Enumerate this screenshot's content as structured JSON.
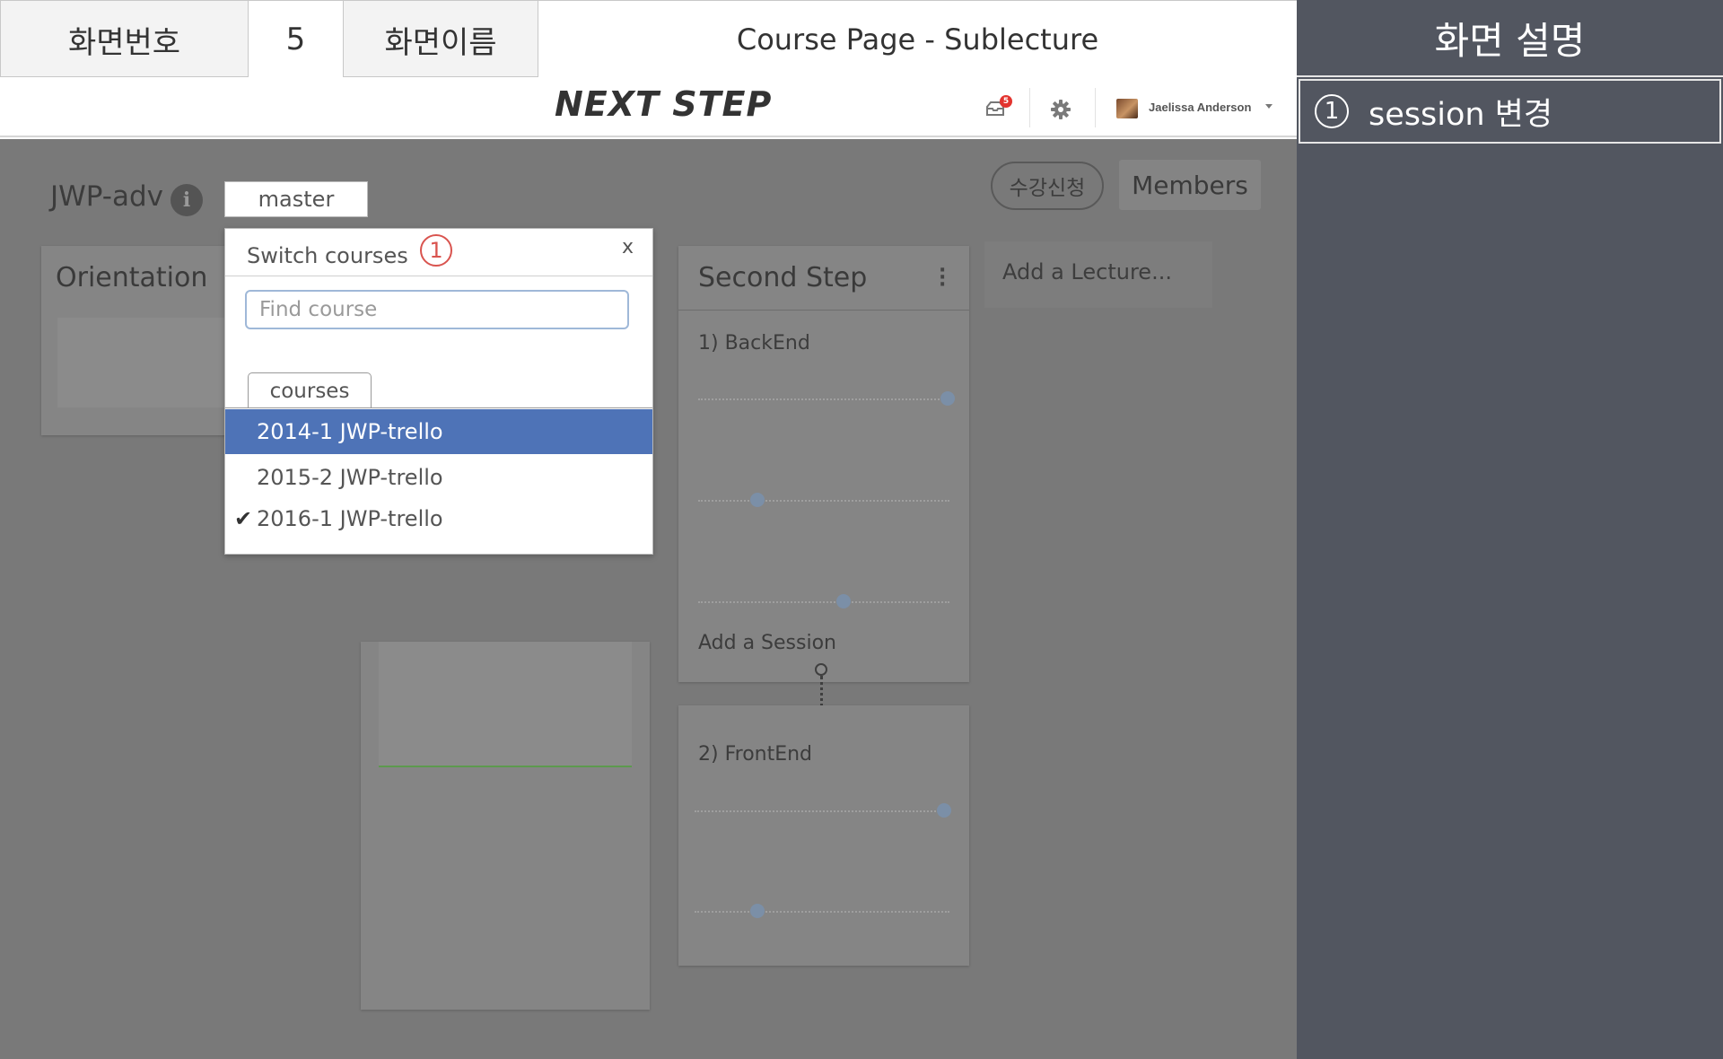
{
  "spec": {
    "screen_no_label": "화면번호",
    "screen_no_value": "5",
    "screen_name_label": "화면이름",
    "screen_name_value": "Course Page - Sublecture"
  },
  "description": {
    "title": "화면 설명",
    "items": [
      {
        "number": "1",
        "text": "session 변경"
      }
    ]
  },
  "navbar": {
    "logo": "NEXT STEP",
    "notification_count": "5",
    "notification_icon": "inbox-icon",
    "settings_icon": "gear-icon",
    "user_name": "Jaelissa Anderson"
  },
  "course": {
    "title": "JWP-adv",
    "info_icon": "info-icon",
    "branch": "master",
    "enroll_label": "수강신청",
    "members_label": "Members"
  },
  "lanes": {
    "orientation": {
      "title": "Orientation"
    },
    "second_step": {
      "title": "Second Step",
      "lectures": [
        {
          "label": "1) BackEnd",
          "add_session": "Add a Session"
        },
        {
          "label": "2) FrontEnd"
        }
      ]
    },
    "add_lecture": "Add a Lecture..."
  },
  "popup": {
    "title": "Switch courses",
    "marker": "1",
    "close": "x",
    "search_placeholder": "Find course",
    "tab_label": "courses",
    "courses": [
      {
        "name": "2014-1 JWP-trello",
        "selected": true,
        "current": false
      },
      {
        "name": "2015-2 JWP-trello",
        "selected": false,
        "current": false
      },
      {
        "name": "2016-1 JWP-trello",
        "selected": false,
        "current": true
      }
    ],
    "check_mark": "✔"
  },
  "colors": {
    "selected_item": "#4e73b7",
    "marker": "#d9544f",
    "panel_bg": "#525660",
    "overlay": "#797979"
  }
}
